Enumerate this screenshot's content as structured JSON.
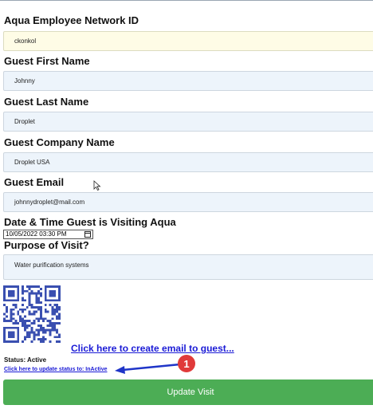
{
  "form": {
    "network_id": {
      "label": "Aqua Employee Network ID",
      "value": "ckonkol"
    },
    "first_name": {
      "label": "Guest First Name",
      "value": "Johnny"
    },
    "last_name": {
      "label": "Guest Last Name",
      "value": "Droplet"
    },
    "company": {
      "label": "Guest Company Name",
      "value": "Droplet USA"
    },
    "email": {
      "label": "Guest Email",
      "value": "johnnydroplet@mail.com"
    },
    "datetime": {
      "label": "Date & Time Guest is Visiting Aqua",
      "value": "10/05/2022 03:30 PM"
    },
    "purpose": {
      "label": "Purpose of Visit?",
      "value": "Water purification systems"
    }
  },
  "links": {
    "create_email": "Click here to create email to guest...",
    "update_status": "Click here to update status to: InActive"
  },
  "status": {
    "text": "Status: Active"
  },
  "actions": {
    "update_label": "Update Visit"
  },
  "annotation": {
    "number": "1"
  },
  "icons": {
    "qr": "qr-code-icon",
    "calendar": "calendar-icon",
    "cursor": "mouse-pointer-icon"
  },
  "colors": {
    "accent_green": "#4cad55",
    "link_blue": "#1a1ad6",
    "annotation_red": "#e03a3a",
    "arrow_blue": "#1f35c8"
  }
}
